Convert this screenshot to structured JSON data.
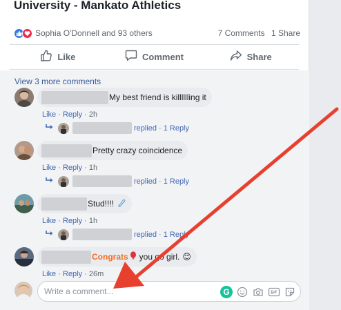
{
  "post": {
    "title": "University - Mankato Athletics",
    "reactions_text": "Sophia O'Donnell and 93 others",
    "comments_count": "7 Comments",
    "shares_count": "1 Share"
  },
  "actions": {
    "like": "Like",
    "comment": "Comment",
    "share": "Share"
  },
  "comments_section": {
    "view_more": "View 3 more comments",
    "items": [
      {
        "text": "My best friend is killlllling it",
        "like": "Like",
        "reply": "Reply",
        "time": "2h",
        "replied": "replied",
        "reply_count": "1 Reply"
      },
      {
        "text": "Pretty crazy coincidence",
        "like": "Like",
        "reply": "Reply",
        "time": "1h",
        "replied": "replied",
        "reply_count": "1 Reply"
      },
      {
        "text": "Stud!!!!",
        "like": "Like",
        "reply": "Reply",
        "time": "1h",
        "replied": "replied",
        "reply_count": "1 Reply"
      },
      {
        "text_prefix": "Congrats",
        "text": "you go girl.",
        "emoji": "😊",
        "like": "Like",
        "reply": "Reply",
        "time": "26m"
      }
    ]
  },
  "composer": {
    "placeholder": "Write a comment..."
  },
  "colors": {
    "link": "#385898",
    "like_blue": "#3578e5",
    "love_red": "#f0284a",
    "annotation_arrow": "#e8402f",
    "grammarly": "#15c39a"
  }
}
